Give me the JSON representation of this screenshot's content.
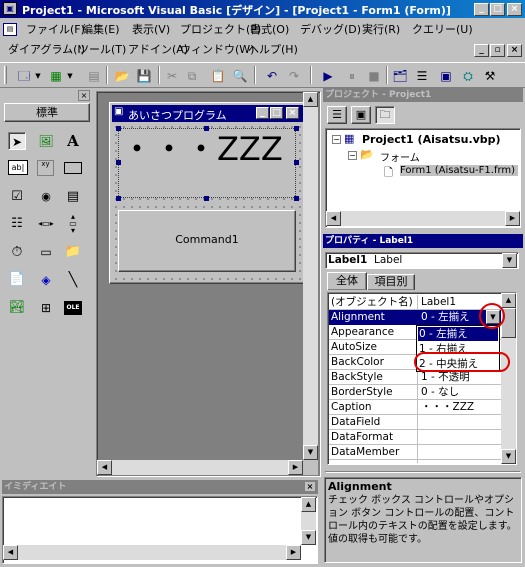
{
  "app": {
    "title": "Project1 - Microsoft Visual Basic [デザイン] - [Project1 - Form1 (Form)]",
    "title_buttons": [
      "_",
      "□",
      "×"
    ],
    "mdi_buttons": [
      "_",
      "▫",
      "×"
    ]
  },
  "menubar": {
    "row1": [
      "ファイル(F)",
      "編集(E)",
      "表示(V)",
      "プロジェクト(P)",
      "書式(O)",
      "デバッグ(D)",
      "実行(R)",
      "クエリー(U)"
    ],
    "row2": [
      "ダイアグラム(I)",
      "ツール(T)",
      "アドイン(A)",
      "ウィンドウ(W)",
      "ヘルプ(H)"
    ]
  },
  "toolbar": {
    "icons": [
      "add-project-icon",
      "add-form-icon",
      "menu-editor-icon",
      "open-icon",
      "save-icon",
      "cut-icon",
      "copy-icon",
      "paste-icon",
      "find-icon",
      "undo-icon",
      "redo-icon",
      "run-icon",
      "pause-icon",
      "stop-icon",
      "project-explorer-icon",
      "properties-icon",
      "form-layout-icon",
      "object-browser-icon",
      "toolbox-icon"
    ]
  },
  "toolbox": {
    "header": "標準",
    "tools": [
      "pointer",
      "picture-box",
      "label",
      "text-box",
      "frame",
      "command-button",
      "check-box",
      "option-button",
      "combo-box",
      "list-box",
      "hscroll",
      "vscroll",
      "timer",
      "drive-list",
      "dir-list",
      "file-list",
      "shape",
      "line",
      "image",
      "data",
      "ole"
    ]
  },
  "form": {
    "title": "あいさつプログラム",
    "label_caption": "・・・ZZZ",
    "button_caption": "Command1"
  },
  "project": {
    "title": "プロジェクト - Project1",
    "root": "Project1 (Aisatsu.vbp)",
    "folder": "フォーム",
    "item": "Form1 (Aisatsu-F1.frm)"
  },
  "properties": {
    "title": "プロパティ - Label1",
    "object_name": "Label1",
    "object_type": "Label",
    "tabs": [
      "全体",
      "項目別"
    ],
    "rows": [
      {
        "name": "(オブジェクト名)",
        "value": "Label1"
      },
      {
        "name": "Alignment",
        "value": "0 - 左揃え"
      },
      {
        "name": "Appearance",
        "value": ""
      },
      {
        "name": "AutoSize",
        "value": ""
      },
      {
        "name": "BackColor",
        "value": ""
      },
      {
        "name": "BackStyle",
        "value": "1 - 不透明"
      },
      {
        "name": "BorderStyle",
        "value": "0 - なし"
      },
      {
        "name": "Caption",
        "value": "・・・ZZZ"
      },
      {
        "name": "DataField",
        "value": ""
      },
      {
        "name": "DataFormat",
        "value": ""
      },
      {
        "name": "DataMember",
        "value": ""
      }
    ],
    "dropdown_options": [
      "0 - 左揃え",
      "1 - 右揃え",
      "2 - 中央揃え"
    ],
    "desc_title": "Alignment",
    "desc_text": "チェック ボックス コントロールやオプション ボタン コントロールの配置、コントロール内のテキストの配置を設定します。値の取得も可能です。"
  },
  "immediate": {
    "title": "イミディエイト"
  },
  "colors": {
    "active_title": "#000080",
    "inactive_title": "#808080",
    "highlight_circle": "#e00000"
  }
}
